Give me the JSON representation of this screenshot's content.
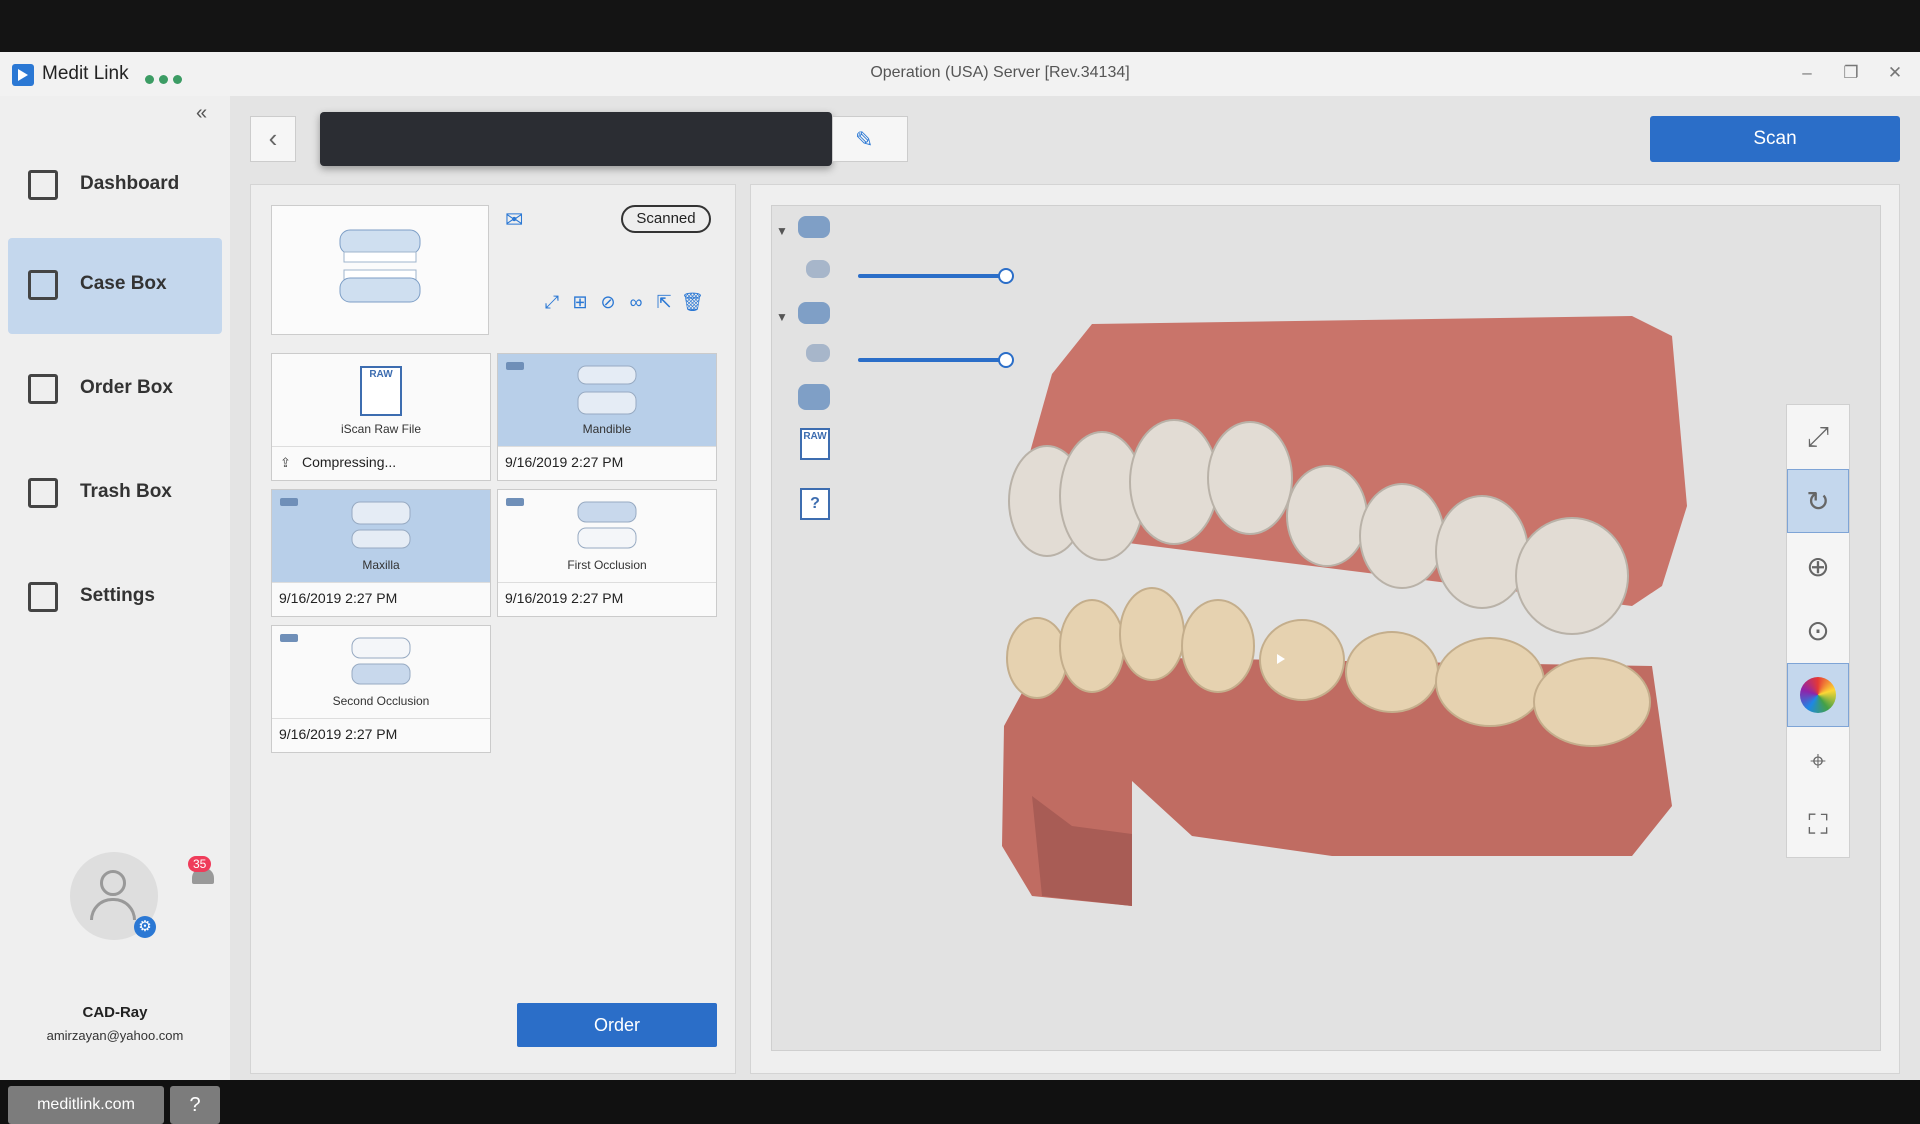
{
  "app": {
    "name": "Medit Link",
    "window_title": "Operation (USA) Server [Rev.34134]",
    "window_controls": [
      "minimize",
      "restore",
      "close"
    ]
  },
  "sidebar": {
    "collapse_icon": "double-chevron-left-icon",
    "items": [
      {
        "label": "Dashboard",
        "icon": "dashboard-icon",
        "active": false
      },
      {
        "label": "Case Box",
        "icon": "case-box-icon",
        "active": true
      },
      {
        "label": "Order Box",
        "icon": "order-box-icon",
        "active": false
      },
      {
        "label": "Trash Box",
        "icon": "trash-box-icon",
        "active": false
      },
      {
        "label": "Settings",
        "icon": "settings-icon",
        "active": false
      }
    ],
    "user": {
      "name": "CAD-Ray",
      "email": "amirzayan@yahoo.com",
      "notifications": "35"
    },
    "site_button": "meditlink.com",
    "help_icon": "help-icon"
  },
  "header": {
    "back_icon": "chevron-left-icon",
    "case_name": "",
    "edit_icon": "edit-icon",
    "scan_label": "Scan"
  },
  "case_panel": {
    "status": "Scanned",
    "files": [
      {
        "label": "iScan Raw File",
        "footer": "Compressing...",
        "selected": false
      },
      {
        "label": "Mandible",
        "footer": "9/16/2019 2:27 PM",
        "selected": true
      },
      {
        "label": "Maxilla",
        "footer": "9/16/2019 2:27 PM",
        "selected": true
      },
      {
        "label": "First Occlusion",
        "footer": "9/16/2019 2:27 PM",
        "selected": false
      },
      {
        "label": "Second Occlusion",
        "footer": "9/16/2019 2:27 PM",
        "selected": false
      }
    ],
    "raw_badge": "RAW",
    "order_label": "Order"
  },
  "viewer": {
    "tree_icons": [
      "occlusion-group-icon",
      "maxilla-icon",
      "mandible-group-icon",
      "mandible-icon",
      "jaw-icon",
      "raw-file-icon",
      "unknown-file-icon"
    ],
    "opacity_sliders": [
      1.0,
      1.0
    ],
    "right_toolbar": [
      "fit-screen-icon",
      "rotate-icon",
      "zoom-in-icon",
      "zoom-fit-icon",
      "color-map-icon",
      "focus-icon",
      "section-icon"
    ],
    "active_tools": [
      "rotate-icon",
      "color-map-icon"
    ],
    "colors": {
      "gum": "#c9746a",
      "teeth": "#e8e0d4",
      "accent": "#2b6ec8"
    }
  }
}
